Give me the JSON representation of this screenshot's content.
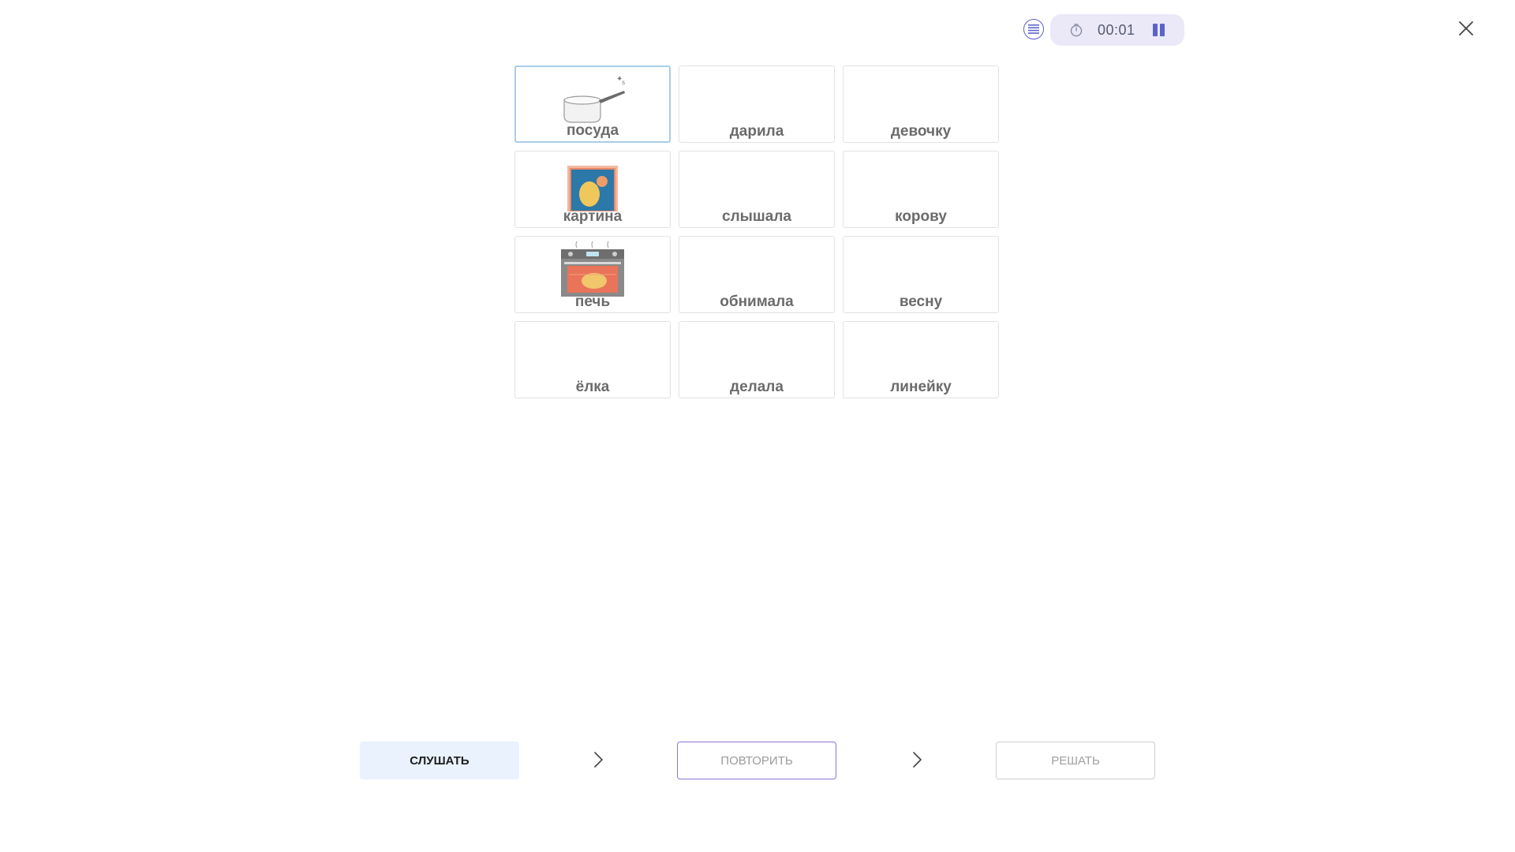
{
  "header": {
    "timer": "00:01"
  },
  "icons": {
    "list": "list-icon",
    "timer": "stopwatch-icon",
    "pause": "pause-icon",
    "close": "close-icon",
    "next_arrow": "chevron-right-icon"
  },
  "colors": {
    "accent": "#5b63c9",
    "pill_background": "#ebe9f8",
    "selected_border": "#a9cde7",
    "listen_background": "#e9f2fd",
    "repeat_border": "#8f74d9"
  },
  "cards": [
    {
      "word": "посуда",
      "image": "saucepan",
      "selected": true
    },
    {
      "word": "дарила",
      "image": null,
      "selected": false
    },
    {
      "word": "девочку",
      "image": null,
      "selected": false
    },
    {
      "word": "картина",
      "image": "painting",
      "selected": false
    },
    {
      "word": "слышала",
      "image": null,
      "selected": false
    },
    {
      "word": "корову",
      "image": null,
      "selected": false
    },
    {
      "word": "печь",
      "image": "oven",
      "selected": false
    },
    {
      "word": "обнимала",
      "image": null,
      "selected": false
    },
    {
      "word": "весну",
      "image": null,
      "selected": false
    },
    {
      "word": "ёлка",
      "image": null,
      "selected": false
    },
    {
      "word": "делала",
      "image": null,
      "selected": false
    },
    {
      "word": "линейку",
      "image": null,
      "selected": false
    }
  ],
  "buttons": {
    "listen": "СЛУШАТЬ",
    "repeat": "ПОВТОРИТЬ",
    "solve": "РЕШАТЬ"
  }
}
